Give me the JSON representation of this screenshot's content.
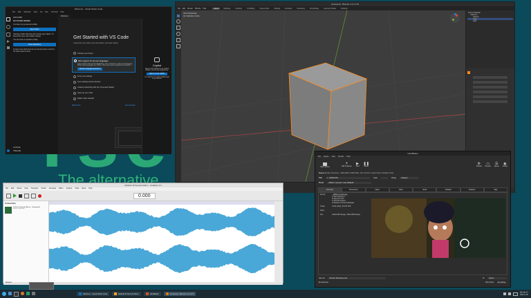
{
  "desktop": {
    "wallpaper_text": "The alternative",
    "wallpaper_big": "rse"
  },
  "vscode": {
    "title": "Welcome - Visual Studio Code",
    "menu": [
      "File",
      "Edit",
      "Selection",
      "View",
      "Go",
      "Run",
      "Terminal",
      "Help"
    ],
    "tab": "Welcome",
    "explorer_header": "EXPLORER",
    "no_folder": "NO FOLDER OPENED",
    "explorer_text1": "You have not yet opened a folder.",
    "open_folder_btn": "Open Folder",
    "explorer_text2": "Opening a folder will close all currently open editors. To keep them open, add a folder instead.",
    "explorer_text3": "You can clone a repository locally.",
    "clone_btn": "Clone Repository",
    "explorer_text4": "To learn more about how to use Git and source control in VS Code read our docs.",
    "outline": "OUTLINE",
    "timeline": "TIMELINE",
    "gs_title": "Get Started with VS Code",
    "gs_sub": "Customize your editor, learn the basics, and start coding",
    "steps": [
      "Choose your theme",
      "Rich support for all your languages",
      "Tune your settings",
      "Sync settings across devices",
      "Unlock productivity with the Command Palette",
      "Open up your code",
      "Watch video tutorials"
    ],
    "step_detail": "Code smarter with syntax highlighting, code completion, linting and debugging. While many languages are built-in, many more can be added as extensions.",
    "browse_btn": "Browse Language Extensions",
    "mark_done": "Mark Done",
    "next_section": "Next Section",
    "copilot_title": "Copilot",
    "copilot_text": "Sign in with GitHub to use GitHub Copilot, your AI pair programmer.",
    "copilot_btn": "Sign in to use Copilot",
    "copilot_sub": "Or explore the Copilot walkthrough to get started."
  },
  "blender": {
    "title": "[Unsaved] - Blender 4.2.3 LTS",
    "menu": [
      "File",
      "Edit",
      "Render",
      "Window",
      "Help"
    ],
    "workspaces": [
      "Layout",
      "Modeling",
      "Sculpting",
      "UV Editing",
      "Texture Paint",
      "Shading",
      "Animation",
      "Rendering",
      "Compositing",
      "Geometry Nodes",
      "Scripting"
    ],
    "viewport_label": "User Perspective",
    "viewport_sub": "(1) Collection | Cube",
    "outliner": [
      "Scene Collection",
      "Collection",
      "Camera",
      "Cube",
      "Light"
    ],
    "timeline": [
      "Playback",
      "Keying",
      "View",
      "Marker"
    ],
    "frame_start": "Start 1",
    "frame_end": "End 250"
  },
  "audacity": {
    "title": "Diabolic El Sounds Album - Audacity 3.6",
    "menu": [
      "File",
      "Edit",
      "Select",
      "View",
      "Transport",
      "Tracks",
      "Generate",
      "Effect",
      "Analyze",
      "Tools",
      "Extra",
      "Help"
    ],
    "time": "0.000",
    "track_panel": "Tracked Files",
    "track_name": "Diabolic El Sounds Album - Single(mp3)",
    "track_sub": "Stereo, 44100Hz",
    "status": "Stopped.",
    "project_rate": "Project Rate (Hz)",
    "rate_value": "44100"
  },
  "handbrake": {
    "title": "HandBrake",
    "menu": [
      "File",
      "Queue",
      "View",
      "Presets",
      "Help"
    ],
    "toolbar_left": [
      "Open Source"
    ],
    "toolbar_mid": [
      "Add To Queue",
      "Start",
      "Pause"
    ],
    "toolbar_right": [
      "Presets",
      "Preview",
      "Queue",
      "Activity"
    ],
    "source_label": "Source",
    "source_value": "Monster Showcase - 1920x1080 (1.0000 PAR), 16:9, 24 FPS, 1 Audio Track, 0 Subtitle Tracks",
    "title_label": "Title",
    "title_value": "1 - 00h00m35s",
    "angle_label": "Angle",
    "range_label": "Range",
    "range_value": "Chapters",
    "preset_label": "Preset",
    "preset_value": "Official > General > Fast 1080p30",
    "tabs": [
      "Summary",
      "Dimensions",
      "Filters",
      "Video",
      "Audio",
      "Subtitles",
      "Chapters",
      "Tags"
    ],
    "format_label": "Format",
    "format_value": "MPEG-4 (avformat)",
    "opt1": "Web Optimized",
    "opt2": "Align A/V Start",
    "opt3": "iPod 5G Support",
    "opt4": "Passthru Common Metadata",
    "tracks_label": "Tracks",
    "tracks_value": "H.264 (x264), 30 FPS PFR",
    "filters_label": "Filters",
    "size_label": "Size",
    "size_value": "1920x1080 Storage, 1920x1080 Display",
    "save_label": "Save As:",
    "save_value": "Monster Showcase.mp4",
    "to_label": "To:",
    "to_value": "Videos",
    "when_done": "When Done:",
    "when_done_value": "Do nothing",
    "encode_done": "Encode Done"
  },
  "taskbar": {
    "items": [
      "Welcome - Visual Studio Code",
      "Diabolic El Sounds Album",
      "HandBrake",
      "[Unsaved] - Blender 4.2.3 LTS"
    ],
    "clock": "19:19:17",
    "date": "2024-11-05"
  },
  "colors": {
    "vscode_bg": "#1f1f1f",
    "vscode_accent": "#0e70c0",
    "blender_bg": "#3a3a3a",
    "blender_header": "#2b2b2b",
    "audacity_wave": "#4aa8d8",
    "handbrake_bg": "#2d2d2d",
    "taskbar": "#1b2a33",
    "wallpaper_text": "#2fb37a"
  }
}
